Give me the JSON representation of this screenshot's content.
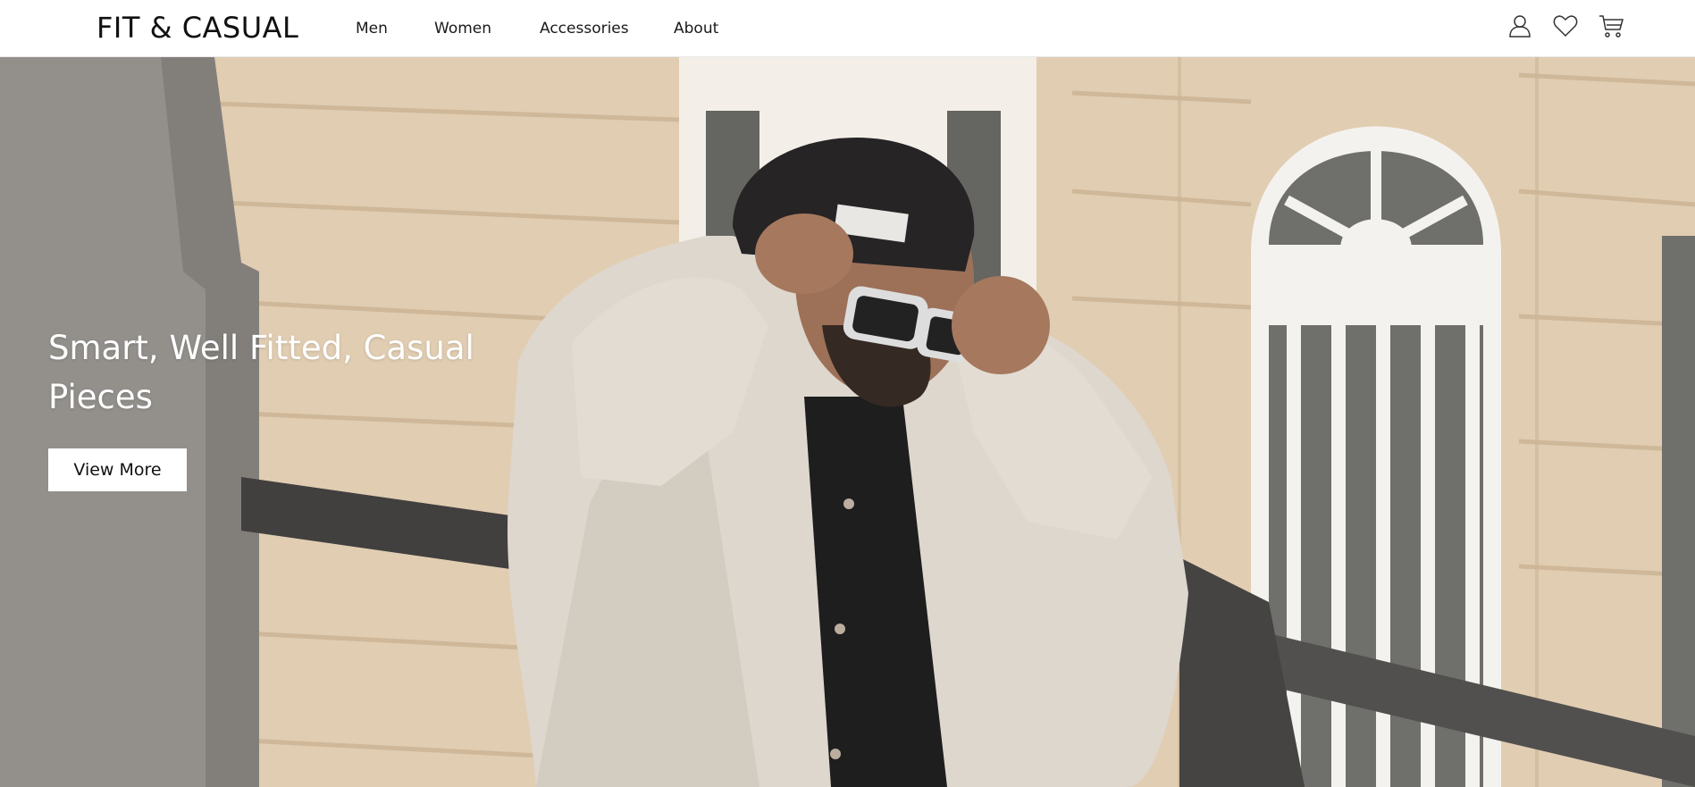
{
  "brand": {
    "name": "FIT & CASUAL"
  },
  "nav": {
    "items": [
      {
        "label": "Men"
      },
      {
        "label": "Women"
      },
      {
        "label": "Accessories"
      },
      {
        "label": "About"
      }
    ],
    "icons": [
      "user-icon",
      "heart-icon",
      "cart-icon"
    ]
  },
  "hero": {
    "title": "Smart, Well Fitted, Casual Pieces",
    "cta_label": "View More"
  },
  "colors": {
    "nav_bg": "#ffffff",
    "text": "#111111",
    "hero_wall": "#e2cdb0",
    "hero_text": "#ffffff"
  }
}
